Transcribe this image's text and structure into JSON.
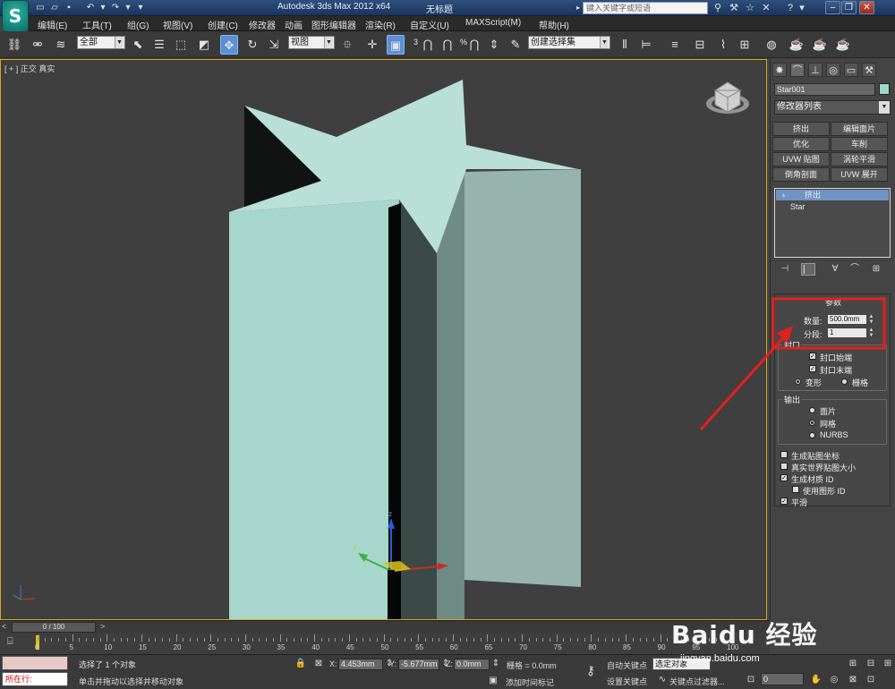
{
  "window": {
    "title": "Autodesk 3ds Max  2012 x64",
    "document": "无标题",
    "search_placeholder": "键入关键字或短语"
  },
  "menu": [
    {
      "label": "编辑(E)"
    },
    {
      "label": "工具(T)"
    },
    {
      "label": "组(G)"
    },
    {
      "label": "视图(V)"
    },
    {
      "label": "创建(C)"
    },
    {
      "label": "修改器"
    },
    {
      "label": "动画"
    },
    {
      "label": "图形编辑器"
    },
    {
      "label": "渲染(R)"
    },
    {
      "label": "自定义(U)"
    },
    {
      "label": "MAXScript(M)"
    },
    {
      "label": "帮助(H)"
    }
  ],
  "toolbar": {
    "selection_filter": "全部",
    "reference_coord": "视图",
    "snap_3": "3",
    "snap_percent": "%",
    "named_selection": "创建选择集"
  },
  "viewport": {
    "label": "[ + ] 正交 ] 真实 ]",
    "label_parts": [
      "[ + ]",
      "正交",
      "真实"
    ]
  },
  "command_panel": {
    "object_name": "Star001",
    "object_color": "#9ed8c8",
    "modifier_list": "修改器列表",
    "modifier_buttons": [
      {
        "label": "挤出"
      },
      {
        "label": "编辑面片"
      },
      {
        "label": "优化"
      },
      {
        "label": "车削"
      },
      {
        "label": "UVW 贴图"
      },
      {
        "label": "涡轮平滑"
      },
      {
        "label": "倒角剖面"
      },
      {
        "label": "UVW 展开"
      }
    ],
    "stack": [
      {
        "label": "挤出",
        "selected": true
      },
      {
        "label": "Star",
        "selected": false
      }
    ],
    "params": {
      "title": "参数",
      "amount_label": "数量:",
      "amount_value": "500.0mm",
      "segments_label": "分段:",
      "segments_value": "1",
      "capping_label": "封口",
      "cap_start": "封口始端",
      "cap_end": "封口末端",
      "morph": "变形",
      "grid": "栅格",
      "output_label": "输出",
      "patch": "面片",
      "mesh": "网格",
      "nurbs": "NURBS",
      "gen_map_coords": "生成贴图坐标",
      "real_world_map_size": "真实世界贴图大小",
      "gen_mat_ids": "生成材质 ID",
      "use_shape_ids": "使用图形 ID",
      "smooth": "平滑"
    }
  },
  "timeline": {
    "slider": "0 / 100",
    "ticks": [
      "0",
      "5",
      "10",
      "15",
      "20",
      "25",
      "30",
      "35",
      "40",
      "45",
      "50",
      "55",
      "60",
      "65",
      "70",
      "75",
      "80",
      "85",
      "90",
      "95",
      "100"
    ]
  },
  "status": {
    "maxscript_label": "所在行:",
    "selected": "选择了 1 个对象",
    "prompt": "单击并拖动以选择并移动对象",
    "x_label": "X:",
    "x_value": "4.453mm",
    "y_label": "Y:",
    "y_value": "-5.677mm",
    "z_label": "Z:",
    "z_value": "0.0mm",
    "grid": "栅格 = 0.0mm",
    "add_time_tag": "添加时间标记",
    "auto_key": "自动关键点",
    "set_key": "设置关键点",
    "set_key_dd": "选定对象",
    "key_filters": "关键点过滤器...",
    "frame": "0"
  },
  "watermark": {
    "brand": "Baidu 经验",
    "url": "jingyan.baidu.com"
  }
}
